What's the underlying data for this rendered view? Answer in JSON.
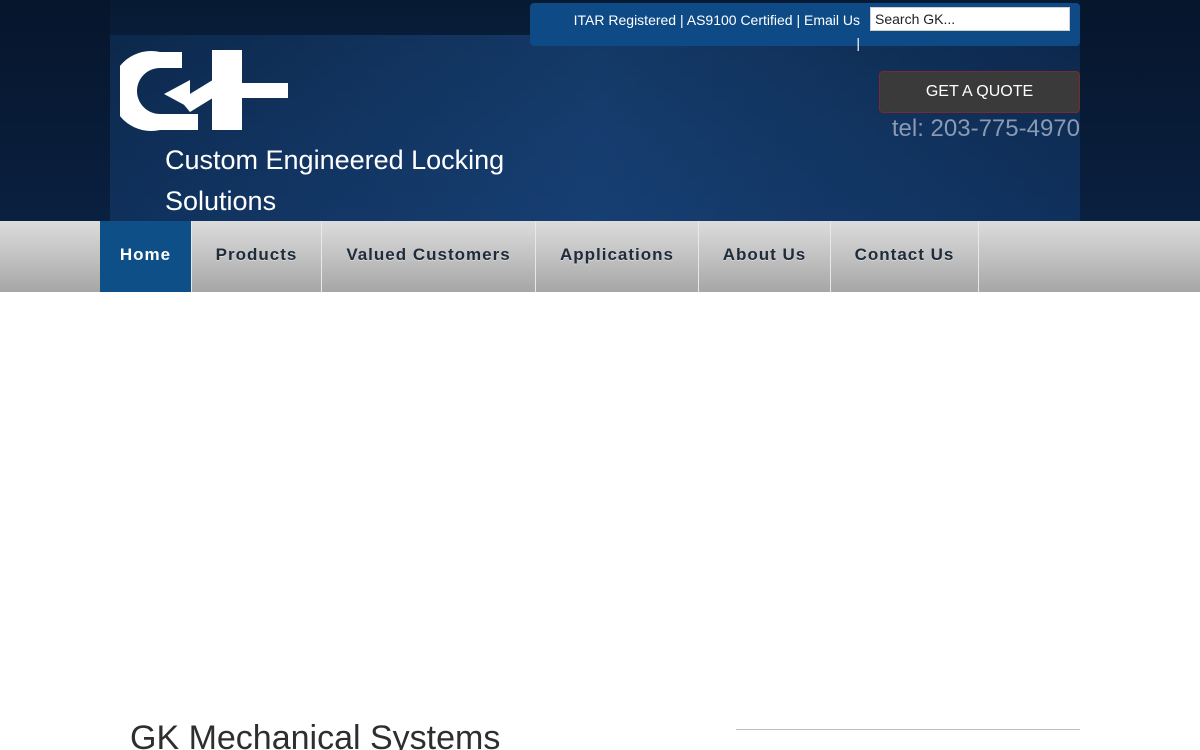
{
  "header": {
    "topbar_links": "ITAR Registered | AS9100 Certified | Email Us |",
    "search": {
      "placeholder": "Search GK..."
    },
    "tagline": "Custom Engineered Locking Solutions",
    "quote_button": "GET A QUOTE",
    "phone": "tel: 203-775-4970"
  },
  "nav": {
    "items": [
      {
        "label": "Home",
        "active": true
      },
      {
        "label": "Products"
      },
      {
        "label": "Valued Customers"
      },
      {
        "label": "Applications"
      },
      {
        "label": "About Us"
      },
      {
        "label": "Contact Us"
      }
    ]
  },
  "main": {
    "title": "GK Mechanical Systems"
  },
  "colors": {
    "header_bg": "#0b2548",
    "topbar_bg": "#0d4a86",
    "nav_active_bg": "#0d4f86",
    "quote_button_bg": "#3a3a3a",
    "phone_text": "#8a9ab2"
  },
  "icons": {
    "logo": "gk-logo-icon"
  }
}
